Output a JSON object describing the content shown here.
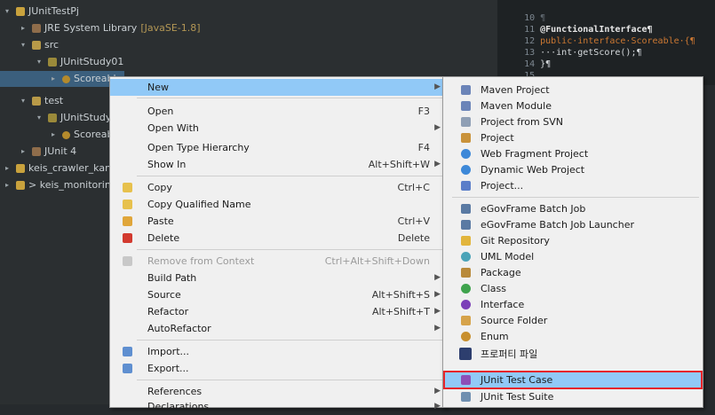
{
  "explorer": {
    "rows": [
      {
        "label": "JUnitTestPj",
        "hint": ""
      },
      {
        "label": "JRE System Library",
        "hint": "[JavaSE-1.8]"
      },
      {
        "label": "src",
        "hint": ""
      },
      {
        "label": "JUnitStudy01",
        "hint": ""
      },
      {
        "label": "Scoreabl",
        "hint": ""
      },
      {
        "label": "test",
        "hint": ""
      },
      {
        "label": "JUnitStudy0",
        "hint": ""
      },
      {
        "label": "Scoreabl",
        "hint": ""
      },
      {
        "label": "JUnit 4",
        "hint": ""
      },
      {
        "label": "keis_crawler_kam",
        "hint": ""
      },
      {
        "label": "> keis_monitorin",
        "hint": ""
      }
    ]
  },
  "editor": {
    "lines": [
      {
        "num": "10",
        "text": "¶"
      },
      {
        "num": "11",
        "text": "@FunctionalInterface¶"
      },
      {
        "num": "12",
        "text": "public·interface·Scoreable·{¶"
      },
      {
        "num": "13",
        "text": "···int·getScore();¶"
      },
      {
        "num": "14",
        "text": "}¶"
      },
      {
        "num": "15",
        "text": ""
      }
    ]
  },
  "context_menu": {
    "items": [
      {
        "label": "New",
        "shortcut": "",
        "submenu": true
      },
      {
        "label": "Open",
        "shortcut": "F3"
      },
      {
        "label": "Open With",
        "shortcut": "",
        "submenu": true
      },
      {
        "label": "Open Type Hierarchy",
        "shortcut": "F4"
      },
      {
        "label": "Show In",
        "shortcut": "Alt+Shift+W",
        "submenu": true
      },
      {
        "label": "Copy",
        "shortcut": "Ctrl+C"
      },
      {
        "label": "Copy Qualified Name",
        "shortcut": ""
      },
      {
        "label": "Paste",
        "shortcut": "Ctrl+V"
      },
      {
        "label": "Delete",
        "shortcut": "Delete"
      },
      {
        "label": "Remove from Context",
        "shortcut": "Ctrl+Alt+Shift+Down"
      },
      {
        "label": "Build Path",
        "shortcut": "",
        "submenu": true
      },
      {
        "label": "Source",
        "shortcut": "Alt+Shift+S",
        "submenu": true
      },
      {
        "label": "Refactor",
        "shortcut": "Alt+Shift+T",
        "submenu": true
      },
      {
        "label": "AutoRefactor",
        "shortcut": "",
        "submenu": true
      },
      {
        "label": "Import...",
        "shortcut": ""
      },
      {
        "label": "Export...",
        "shortcut": ""
      },
      {
        "label": "References",
        "shortcut": "",
        "submenu": true
      },
      {
        "label": "Declarations",
        "shortcut": "",
        "submenu": true
      }
    ]
  },
  "submenu": {
    "items": [
      {
        "label": "Maven Project",
        "icon": "maven-project-icon"
      },
      {
        "label": "Maven Module",
        "icon": "maven-module-icon"
      },
      {
        "label": "Project from SVN",
        "icon": "svn-project-icon"
      },
      {
        "label": "Project",
        "icon": "project-icon"
      },
      {
        "label": "Web Fragment Project",
        "icon": "web-fragment-icon"
      },
      {
        "label": "Dynamic Web Project",
        "icon": "dynamic-web-icon"
      },
      {
        "label": "Project...",
        "icon": "project-wizard-icon"
      },
      {
        "label": "eGovFrame Batch Job",
        "icon": "batch-job-icon"
      },
      {
        "label": "eGovFrame Batch Job Launcher",
        "icon": "batch-launcher-icon"
      },
      {
        "label": "Git Repository",
        "icon": "git-repository-icon"
      },
      {
        "label": "UML Model",
        "icon": "uml-model-icon"
      },
      {
        "label": "Package",
        "icon": "package-icon"
      },
      {
        "label": "Class",
        "icon": "class-icon"
      },
      {
        "label": "Interface",
        "icon": "interface-icon"
      },
      {
        "label": "Source Folder",
        "icon": "source-folder-icon"
      },
      {
        "label": "Enum",
        "icon": "enum-icon"
      },
      {
        "label": "프로퍼티 파일",
        "icon": "properties-file-icon"
      },
      {
        "label": "JUnit Test Case",
        "icon": "junit-test-case-icon"
      },
      {
        "label": "JUnit Test Suite",
        "icon": "junit-test-suite-icon"
      }
    ]
  },
  "colors": {
    "highlight": "#91c9f7",
    "annotation_box": "#e5252b",
    "menu_bg": "#f0f0f0",
    "explorer_bg": "#2b2f31"
  }
}
